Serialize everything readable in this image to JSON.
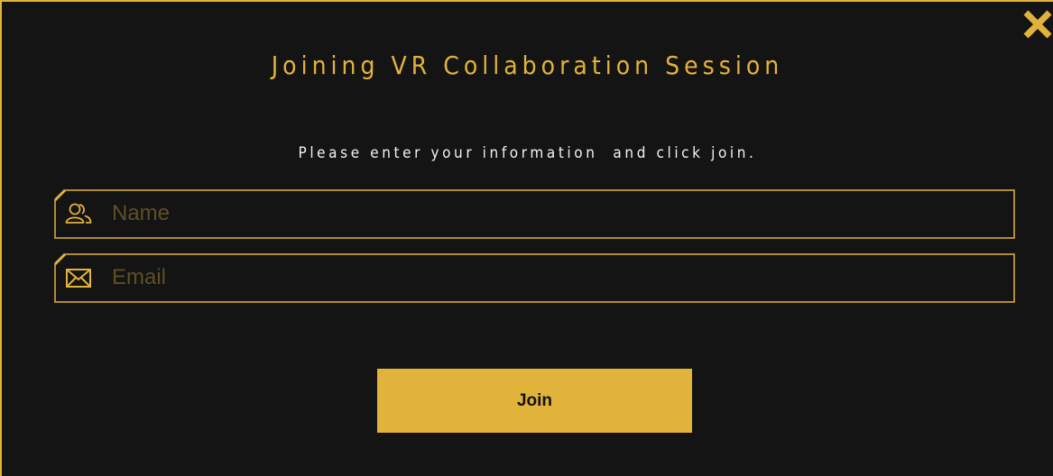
{
  "dialog": {
    "title": "Joining VR Collaboration Session",
    "subtitle": "Please enter your information  and click join.",
    "close_icon": "close-icon",
    "accent_color": "#e2b33a",
    "background_color": "#141414",
    "fields": {
      "name": {
        "icon": "users-icon",
        "placeholder": "Name",
        "value": ""
      },
      "email": {
        "icon": "mail-icon",
        "placeholder": "Email",
        "value": ""
      }
    },
    "join_label": "Join"
  }
}
